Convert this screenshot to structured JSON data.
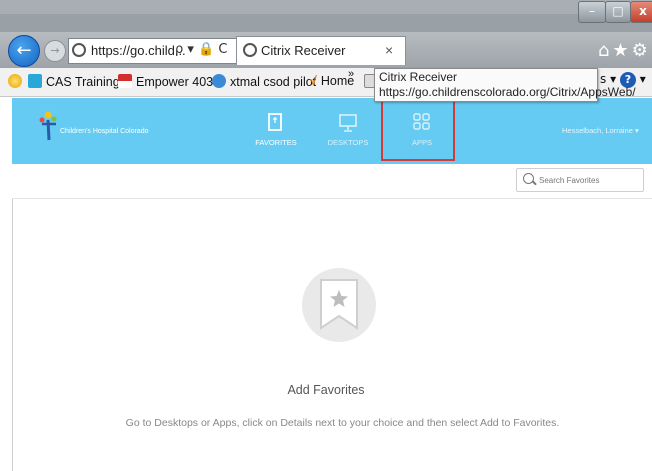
{
  "browser": {
    "window_controls": {
      "minimize": "–",
      "maximize": "□",
      "close": "x"
    },
    "address": "https://go.child...",
    "address_tools": "ρ ▾ 🔒 C",
    "tab_title": "Citrix Receiver",
    "tab_close": "×",
    "nav_right_icons": "⌂★⚙"
  },
  "favorites_bar": {
    "items": [
      {
        "label": "CAS Training"
      },
      {
        "label": "Empower 403"
      },
      {
        "label": "xtmal csod pilot"
      },
      {
        "label": "Home"
      }
    ],
    "more": "»",
    "right_text": "s ▾",
    "help": "?"
  },
  "tooltip": {
    "title": "Citrix Receiver",
    "url": "https://go.childrenscolorado.org/Citrix/AppsWeb/"
  },
  "app": {
    "logo_text": "Children's Hospital Colorado",
    "tabs": [
      {
        "label": "FAVORITES",
        "icon": "bookmark-icon"
      },
      {
        "label": "DESKTOPS",
        "icon": "monitor-icon"
      },
      {
        "label": "APPS",
        "icon": "grid-icon"
      }
    ],
    "user": "Hesselbach, Lorraine ▾",
    "search_placeholder": "Search Favorites",
    "empty_title": "Add Favorites",
    "empty_desc": "Go to Desktops or Apps, click on Details next to your choice and then select Add to Favorites."
  },
  "colors": {
    "header": "#65cbf2",
    "highlight": "#d43a3a"
  }
}
